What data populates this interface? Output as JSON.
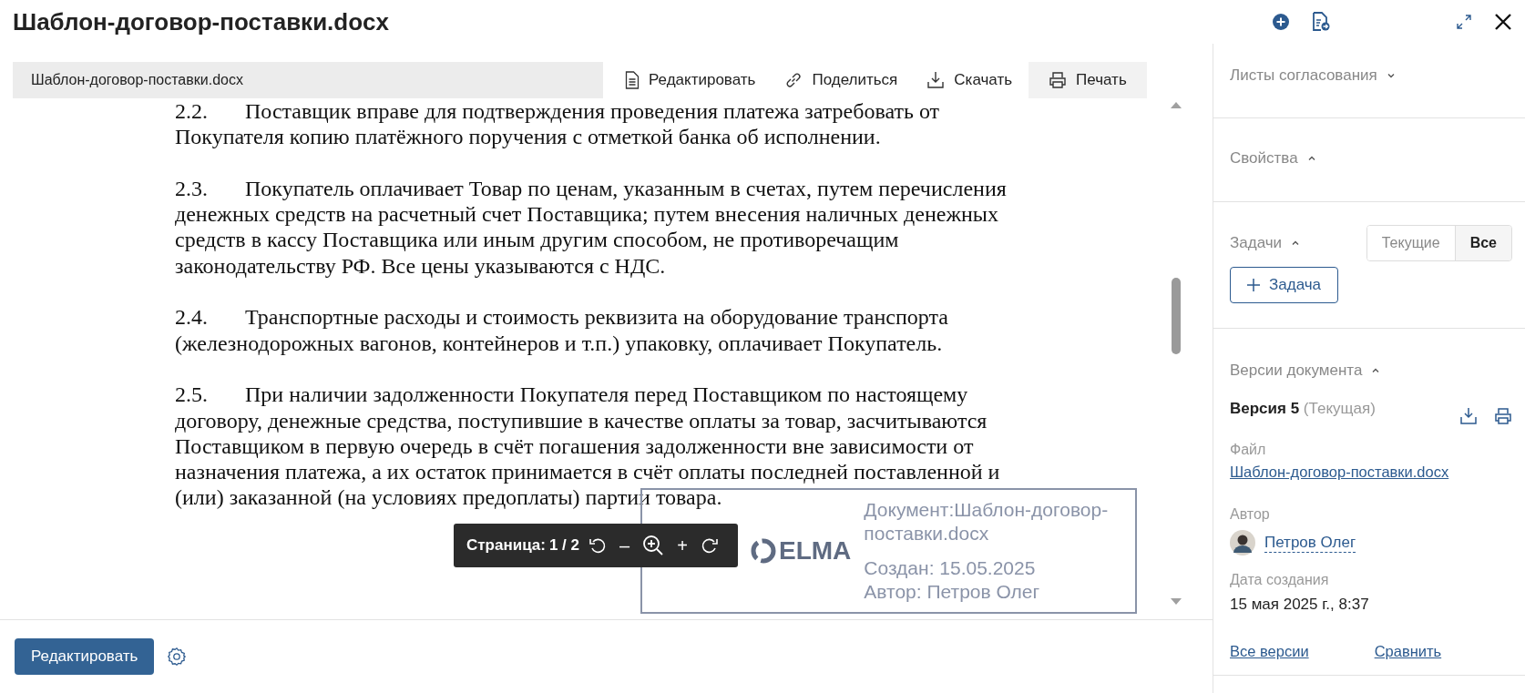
{
  "window": {
    "title": "Шаблон-договор-поставки.docx"
  },
  "viewer": {
    "filename": "Шаблон-договор-поставки.docx",
    "actions": [
      {
        "label": "Редактировать",
        "kind": "edit"
      },
      {
        "label": "Поделиться",
        "kind": "share"
      },
      {
        "label": "Скачать",
        "kind": "download"
      },
      {
        "label": "Печать",
        "kind": "print"
      }
    ],
    "paragraphs": [
      {
        "number": "2.2.",
        "lines": [
          "Поставщик вправе для подтверждения проведения платежа затребовать от",
          "Покупателя копию платёжного поручения с отметкой банка об исполнении."
        ]
      },
      {
        "number": "2.3.",
        "lines": [
          "Покупатель оплачивает Товар по ценам, указанным в счетах, путем перечисления",
          "денежных средств на расчетный счет Поставщика; путем внесения наличных денежных",
          "средств в кассу Поставщика или иным другим способом, не противоречащим",
          "законодательству РФ. Все цены указываются с НДС."
        ]
      },
      {
        "number": "2.4.",
        "lines": [
          "Транспортные расходы и стоимость реквизита на оборудование транспорта",
          "(железнодорожных вагонов, контейнеров и т.п.) упаковку, оплачивает Покупатель."
        ]
      },
      {
        "number": "2.5.",
        "lines": [
          "При наличии задолженности Покупателя перед Поставщиком по настоящему",
          "договору, денежные средства, поступившие в качестве оплаты за товар, засчитываются",
          "Поставщиком в первую очередь в счёт погашения задолженности вне зависимости от",
          "назначения платежа, а их остаток принимается в счёт оплаты последней поставленной и",
          "(или) заказанной (на условиях предоплаты) партии товара."
        ]
      }
    ],
    "stamp": {
      "logo": "ELMA",
      "document": [
        "Документ:Шаблон-договор-",
        "поставки.docx"
      ],
      "created": "Создан: 15.05.2025",
      "author": "Автор: Петров Олег"
    },
    "page_toolbar": {
      "label": "Страница:",
      "page": "1 / 2",
      "zoom_out": "–",
      "zoom_in": "+"
    }
  },
  "footer": {
    "edit_button": "Редактировать"
  },
  "sidebar": {
    "sections": [
      {
        "kind": "approval",
        "title": "Листы согласования",
        "expanded": false
      },
      {
        "kind": "properties",
        "title": "Свойства",
        "expanded": true
      },
      {
        "kind": "tasks",
        "title": "Задачи",
        "expanded": true
      },
      {
        "kind": "versions",
        "title": "Версии документа",
        "expanded": true
      }
    ],
    "task_filters": [
      {
        "label": "Текущие",
        "selected": false
      },
      {
        "label": "Все",
        "selected": true
      }
    ],
    "add_task": "Задача",
    "version": {
      "name": "Версия 5",
      "status": "(Текущая)",
      "file_label": "Файл",
      "file_link": "Шаблон-договор-поставки.docx",
      "author_label": "Автор",
      "author": "Петров Олег",
      "date_label": "Дата создания",
      "date": "15 мая 2025 г., 8:37"
    },
    "links": [
      "Все версии",
      "Сравнить"
    ]
  }
}
